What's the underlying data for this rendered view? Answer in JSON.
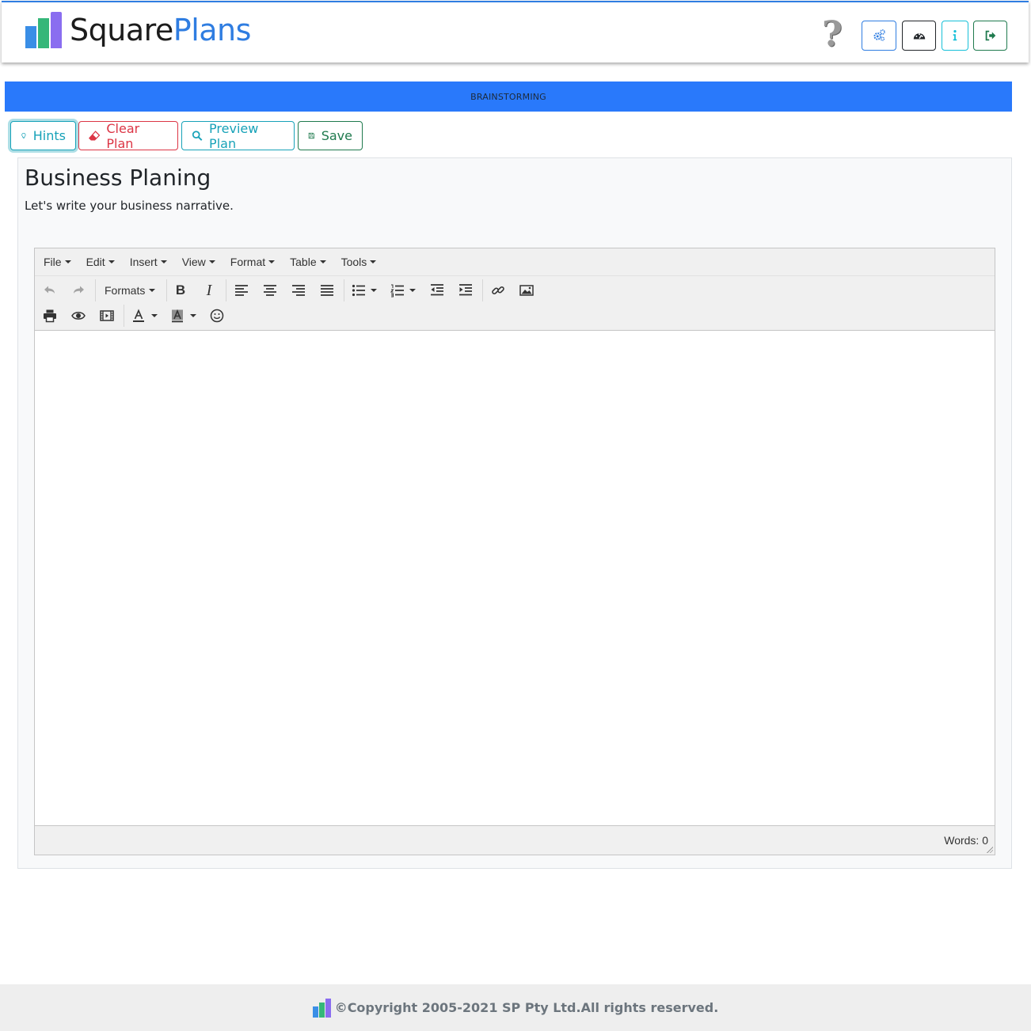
{
  "header": {
    "brand_part1": "Square",
    "brand_part2": "Plans",
    "help_glyph": "?",
    "buttons": [
      {
        "icon": "settings-cogs-icon",
        "color": "#2f7de1"
      },
      {
        "icon": "dashboard-icon",
        "color": "#212529"
      },
      {
        "icon": "info-icon",
        "color": "#17c0d8"
      },
      {
        "icon": "logout-icon",
        "color": "#1f7a4e"
      }
    ]
  },
  "banner": {
    "label": "BRAINSTORMING",
    "color": "#2979fb"
  },
  "actions": {
    "hints": "Hints",
    "clear": "Clear Plan",
    "preview": "Preview Plan",
    "save": "Save"
  },
  "card": {
    "title": "Business Planing",
    "subtitle": "Let's write your business narrative."
  },
  "editor": {
    "menu": [
      "File",
      "Edit",
      "Insert",
      "View",
      "Format",
      "Table",
      "Tools"
    ],
    "formats_label": "Formats",
    "word_count": "Words: 0"
  },
  "footer": {
    "copyright": "©Copyright 2005-2021 SP Pty Ltd.All rights reserved."
  }
}
